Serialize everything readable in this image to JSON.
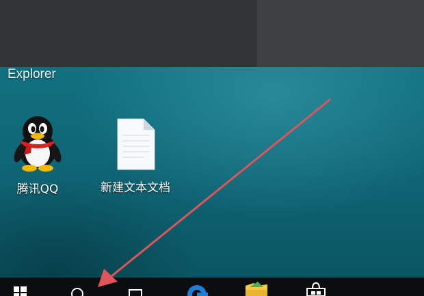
{
  "desktop": {
    "window_caption": "Explorer",
    "icons": [
      {
        "label": "腾讯QQ",
        "icon": "qq-penguin-icon"
      },
      {
        "label": "新建文本文档",
        "icon": "text-document-icon"
      }
    ]
  },
  "taskbar": {
    "items": [
      {
        "name": "start-button",
        "icon": "windows-logo-icon"
      },
      {
        "name": "search-button",
        "icon": "search-icon"
      },
      {
        "name": "task-view-button",
        "icon": "task-view-icon"
      },
      {
        "name": "edge-button",
        "icon": "edge-browser-icon"
      },
      {
        "name": "file-explorer-button",
        "icon": "folder-icon"
      },
      {
        "name": "store-button",
        "icon": "store-bag-icon"
      }
    ]
  },
  "annotation": {
    "type": "arrow",
    "color": "#e05558",
    "points_to": "search-button"
  },
  "colors": {
    "wallpaper": "#0f6676",
    "taskbar": "#0c0d0e",
    "window_top": "#313434"
  }
}
